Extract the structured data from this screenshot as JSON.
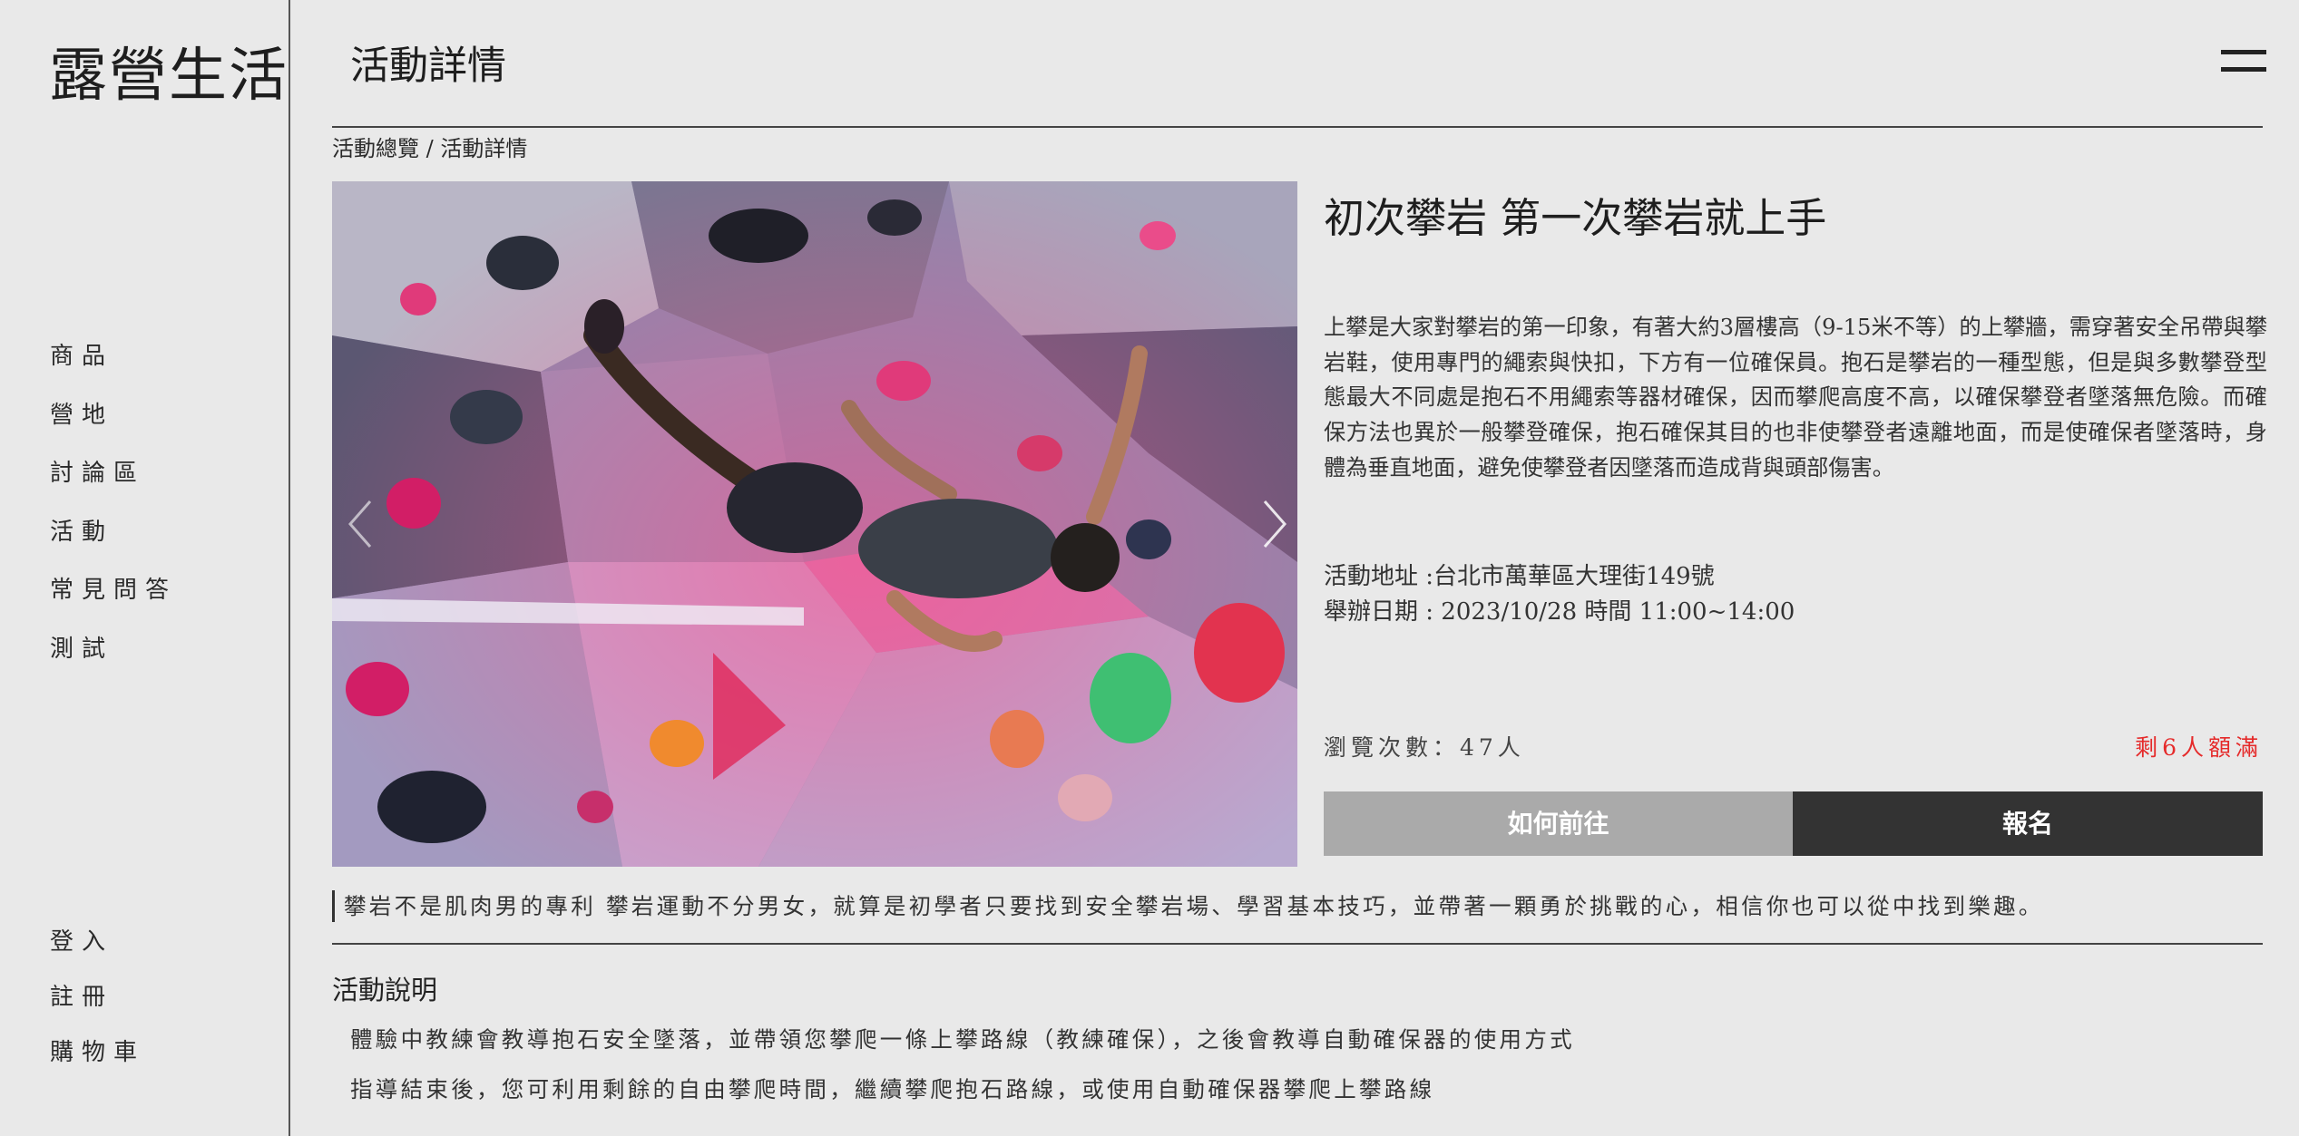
{
  "brand": {
    "logo": "露營生活"
  },
  "nav": {
    "items": [
      {
        "label": "商品"
      },
      {
        "label": "營地"
      },
      {
        "label": "討論區"
      },
      {
        "label": "活動"
      },
      {
        "label": "常見問答"
      },
      {
        "label": "測試"
      }
    ],
    "account": [
      {
        "label": "登入"
      },
      {
        "label": "註冊"
      },
      {
        "label": "購物車"
      }
    ]
  },
  "header": {
    "title": "活動詳情",
    "menu_icon": "hamburger-icon"
  },
  "breadcrumb": {
    "parent": "活動總覽",
    "separator": " / ",
    "current": "活動詳情"
  },
  "carousel": {
    "image_subject": "climber-on-bouldering-wall",
    "prev_icon": "chevron-left-icon",
    "next_icon": "chevron-right-icon"
  },
  "event": {
    "title": "初次攀岩 第一次攀岩就上手",
    "description": "上攀是大家對攀岩的第一印象，有著大約3層樓高（9-15米不等）的上攀牆，需穿著安全吊帶與攀岩鞋，使用專門的繩索與快扣，下方有一位確保員。抱石是攀岩的一種型態，但是與多數攀登型態最大不同處是抱石不用繩索等器材確保，因而攀爬高度不高，以確保攀登者墜落無危險。而確保方法也異於一般攀登確保，抱石確保其目的也非使攀登者遠離地面，而是使確保者墜落時，身體為垂直地面，避免使攀登者因墜落而造成背與頭部傷害。",
    "address_line": "活動地址 :台北市萬華區大理街149號",
    "date_line": "舉辦日期 : 2023/10/28 時間 11:00~14:00",
    "views_line": "瀏覽次數：47人",
    "spots_line": "剩6人額滿",
    "spots_color": "#e52a2a"
  },
  "buttons": {
    "directions": "如何前往",
    "register": "報名"
  },
  "quote": "攀岩不是肌肉男的專利 攀岩運動不分男女，就算是初學者只要找到安全攀岩場、學習基本技巧，並帶著一顆勇於挑戰的心，相信你也可以從中找到樂趣。",
  "details": {
    "heading": "活動說明",
    "lines": [
      "體驗中教練會教導抱石安全墜落，並帶領您攀爬一條上攀路線（教練確保），之後會教導自動確保器的使用方式",
      "指導結束後，您可利用剩餘的自由攀爬時間，繼續攀爬抱石路線，或使用自動確保器攀爬上攀路線"
    ]
  }
}
